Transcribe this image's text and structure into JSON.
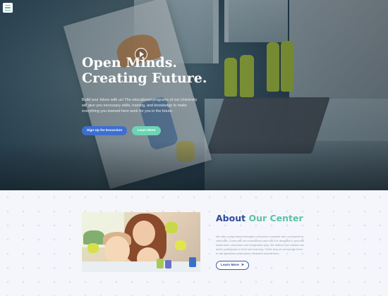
{
  "hero": {
    "title_line1": "Open Minds.",
    "title_line2": "Creating Future.",
    "description": "Build your future with us! The educational programs of our University will give you necessary skills, training, and knowledge to make everything you learned here work for you in the future.",
    "primary_button": "Sign Up for Excursion",
    "secondary_button": "Learn More"
  },
  "menu": {
    "icon": "hamburger-menu-icon"
  },
  "about": {
    "title_part1": "About",
    "title_part2": "Our Center",
    "description": "We offer a play-based emergent curriculum complete with our teacher to child ratio. Come see our environment and how it is designed to promote exploration, adventure and imaginative play. We believe that children are active participants in their own learning. That's why we encourage them to ask questions and explore the world around them.",
    "button": "Learn More",
    "button_icon": "arrow-right-icon",
    "video_icon": "play-icon"
  },
  "colors": {
    "primary_blue": "#3e6fd0",
    "accent_green": "#6cd4b4",
    "title_blue": "#2e4a9b",
    "title_green": "#5bc3a7"
  }
}
